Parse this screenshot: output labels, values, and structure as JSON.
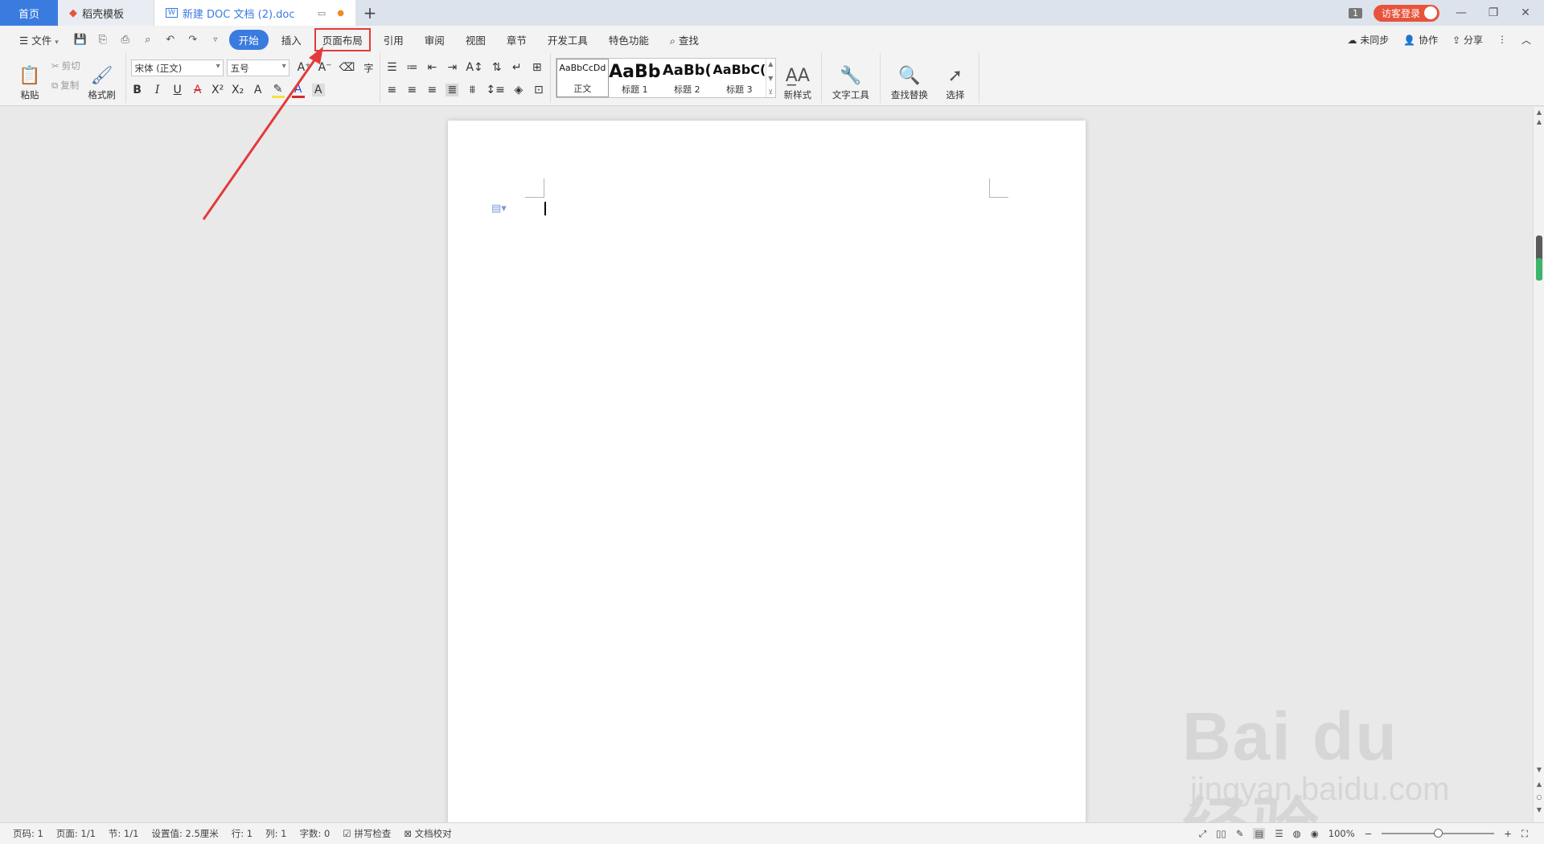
{
  "titlebar": {
    "home_tab": "首页",
    "templates_tab": "稻壳模板",
    "doc_tab": "新建 DOC 文档 (2).doc",
    "add_tab": "+",
    "window_count": "1",
    "visitor_login": "访客登录",
    "minimize": "—",
    "restore": "❐",
    "close": "✕"
  },
  "menu": {
    "file": "文件",
    "tabs": [
      "开始",
      "插入",
      "页面布局",
      "引用",
      "审阅",
      "视图",
      "章节",
      "开发工具",
      "特色功能"
    ],
    "active_tab": "开始",
    "highlighted_tab": "页面布局",
    "search": "查找",
    "sync": "未同步",
    "collab": "协作",
    "share": "分享"
  },
  "ribbon": {
    "paste": "粘贴",
    "cut": "剪切",
    "copy": "复制",
    "format_painter": "格式刷",
    "font_name": "宋体 (正文)",
    "font_size": "五号",
    "styles": [
      {
        "sample": "AaBbCcDd",
        "label": "正文"
      },
      {
        "sample": "AaBb",
        "label": "标题 1"
      },
      {
        "sample": "AaBb(",
        "label": "标题 2"
      },
      {
        "sample": "AaBbC(",
        "label": "标题 3"
      }
    ],
    "new_style": "新样式",
    "text_tools": "文字工具",
    "find_replace": "查找替换",
    "select": "选择"
  },
  "status": {
    "page_num": "页码: 1",
    "pages": "页面: 1/1",
    "section": "节: 1/1",
    "setting": "设置值: 2.5厘米",
    "row": "行: 1",
    "col": "列: 1",
    "word_count": "字数: 0",
    "spell_check": "拼写检查",
    "doc_proof": "文档校对",
    "zoom": "100%"
  },
  "zoom_level": 0.5,
  "watermark": {
    "brand": "Bai du 经验",
    "url": "jingyan.baidu.com"
  },
  "colors": {
    "accent": "#3a7be0",
    "highlight_box": "#e23b3b",
    "annotation_arrow": "#e23b3b"
  }
}
